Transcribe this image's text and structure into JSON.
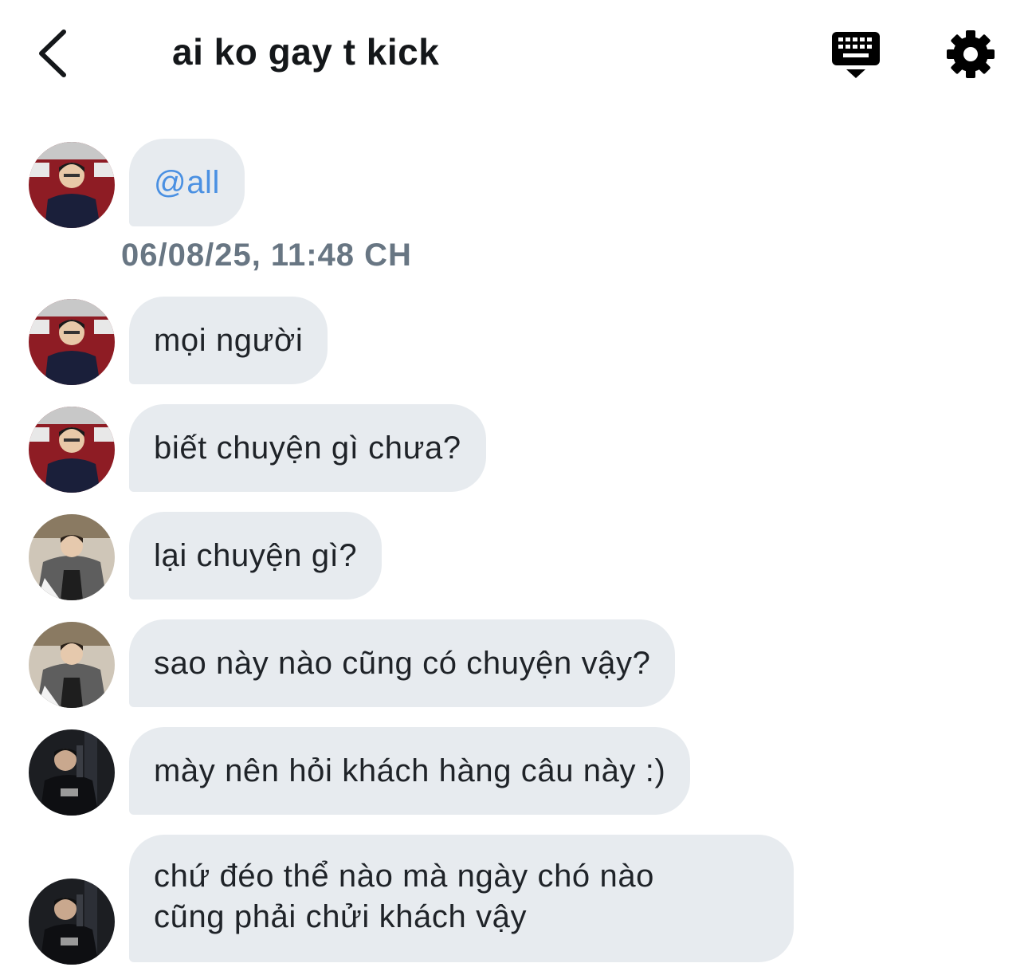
{
  "header": {
    "title": "ai ko gay t kick",
    "back_icon": "chevron-left-icon",
    "keyboard_icon": "keyboard-icon",
    "settings_icon": "gear-icon"
  },
  "colors": {
    "bubble_bg": "#e7ebef",
    "mention": "#4a90e2",
    "timestamp": "#687683",
    "text": "#1f2328"
  },
  "timestamp": "06/08/25, 11:48 CH",
  "messages": [
    {
      "sender": "user-a",
      "text": "@all"
    },
    {
      "sender": "user-a",
      "text": "mọi người"
    },
    {
      "sender": "user-a",
      "text": "biết chuyện gì chưa?"
    },
    {
      "sender": "user-b",
      "text": "lại chuyện gì?"
    },
    {
      "sender": "user-b",
      "text": "sao này nào cũng có chuyện vậy?"
    },
    {
      "sender": "user-c",
      "text": "mày nên hỏi khách hàng câu này :)"
    },
    {
      "sender": "user-c",
      "text_line1": "chứ đéo thể nào mà ngày chó nào",
      "text_line2": "cũng phải chửi khách vậy"
    }
  ]
}
